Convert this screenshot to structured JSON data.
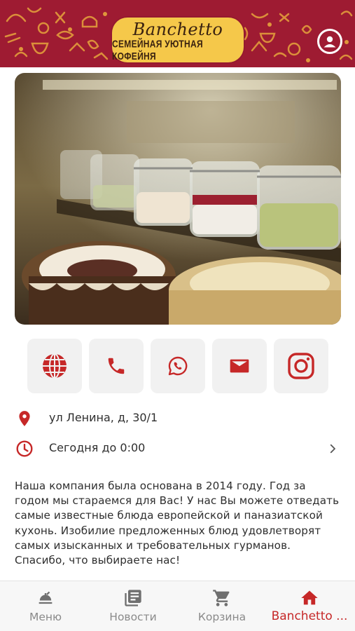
{
  "colors": {
    "brand_red": "#9e1b32",
    "accent_red": "#c62828",
    "logo_yellow": "#f5c84a",
    "button_bg": "#f1f1f1",
    "nav_inactive": "#8a8a8a"
  },
  "header": {
    "logo_name": "Banchetto",
    "logo_tagline": "СЕМЕЙНАЯ УЮТНАЯ КОФЕЙНЯ",
    "account_icon": "account-circle-icon"
  },
  "hero": {
    "image_icon": "photo"
  },
  "actions": [
    {
      "id": "website",
      "icon": "globe-icon"
    },
    {
      "id": "phone",
      "icon": "phone-icon"
    },
    {
      "id": "whatsapp",
      "icon": "whatsapp-icon"
    },
    {
      "id": "email",
      "icon": "mail-icon"
    },
    {
      "id": "instagram",
      "icon": "instagram-icon"
    }
  ],
  "info": {
    "address": "ул Ленина, д, 30/1",
    "hours": "Сегодня до 0:00"
  },
  "description": "Наша компания была основана в 2014 году. Год за годом мы стараемся для Вас! У нас Вы можете отведать самые известные блюда европейской и паназиатской кухонь. Изобилие предложенных блюд удовлетворят самых изысканных и требовательных гурманов. Спасибо, что выбираете нас!",
  "nav": {
    "menu": "Меню",
    "news": "Новости",
    "cart": "Корзина",
    "home": "Banchetto ..."
  }
}
